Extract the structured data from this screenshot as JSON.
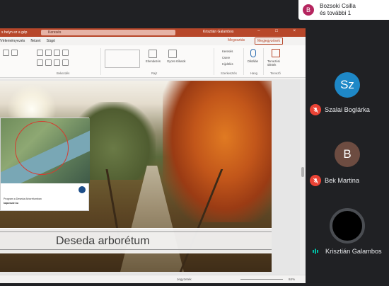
{
  "notification": {
    "avatar_letter": "B",
    "text_line1": "Bozsoki Csilla",
    "text_line2": "és további 1"
  },
  "ppt": {
    "titlebar": {
      "left_text": "s helyn ez a gép",
      "search": "Keresés",
      "user": "Krisztián Galambos",
      "user_initials": "KG",
      "window_controls": "– □ ×"
    },
    "menu": {
      "items": [
        "Véleményezés",
        "Nézet",
        "Súgó"
      ],
      "share": "Megosztás",
      "comments": "Megjegyzések"
    },
    "ribbon": {
      "groups": [
        "Bekezdés",
        "Rajz",
        "Szerkesztés",
        "Hang",
        "Tervezõ"
      ],
      "labels": {
        "elrendezes": "Elrendezés",
        "gyors": "Gyors stílusok",
        "keresés": "Keresés",
        "csere": "Csere",
        "kijeloles": "Kijelölés",
        "diktalas": "Diktálás",
        "tervezo": "Tervezési ötletek"
      }
    },
    "slide": {
      "title": "Deseda arborétum",
      "map_caption_line1": "Program a Deseda Arborétumban",
      "map_caption_line2": "kaposvár.hu"
    },
    "statusbar": {
      "notes": "Jegyzetek",
      "zoom": "84%"
    }
  },
  "participants": [
    {
      "initials": "Sz",
      "name": "Szalai Boglárka",
      "muted": true,
      "color": "#1e88c7"
    },
    {
      "initials": "B",
      "name": "Bek Martina",
      "muted": true,
      "color": "#6d4c41"
    },
    {
      "initials": "",
      "name": "Krisztián Galambos",
      "muted": false,
      "speaking": true,
      "color": "#000000"
    }
  ],
  "colors": {
    "ppt_accent": "#b7472a",
    "mic_off": "#ea4335",
    "bg": "#202124"
  }
}
